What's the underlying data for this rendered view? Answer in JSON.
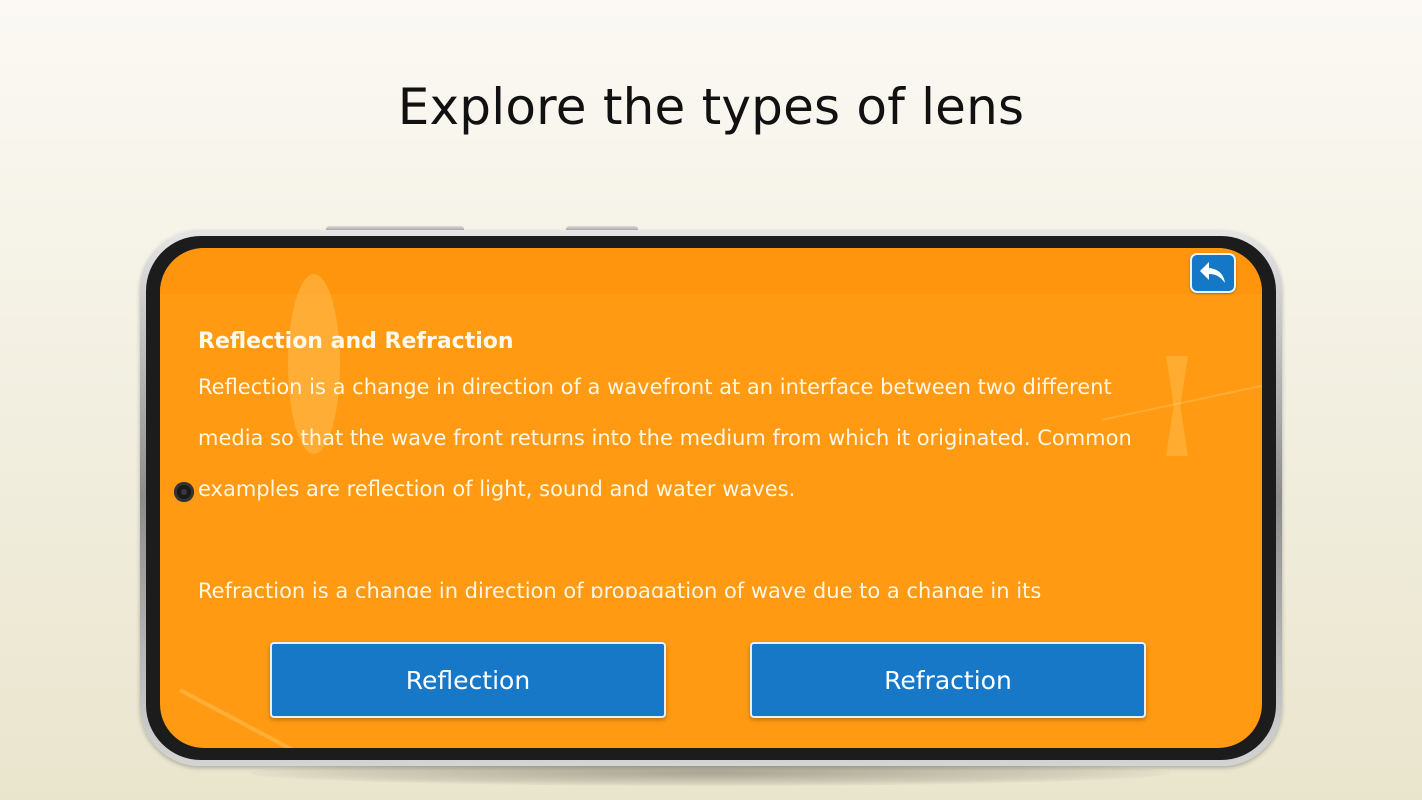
{
  "headline": "Explore the types of lens",
  "colors": {
    "screen_background": "#ff9a12",
    "button_background": "#1778c8",
    "button_border": "#e7f0f7",
    "text": "#fff7ea"
  },
  "screen": {
    "back_button": {
      "icon": "back-arrow-icon"
    },
    "content": {
      "title": "Reflection and Refraction",
      "paragraphs": [
        "Reflection is a change in direction of a wavefront at an interface between two different media so that the wave front returns into the medium from which it originated. Common examples are reflection of light, sound and water waves.",
        "Refraction is a change in direction of propagation of wave due to a change in its"
      ]
    },
    "buttons": {
      "reflection_label": "Reflection",
      "refraction_label": "Refraction"
    }
  }
}
